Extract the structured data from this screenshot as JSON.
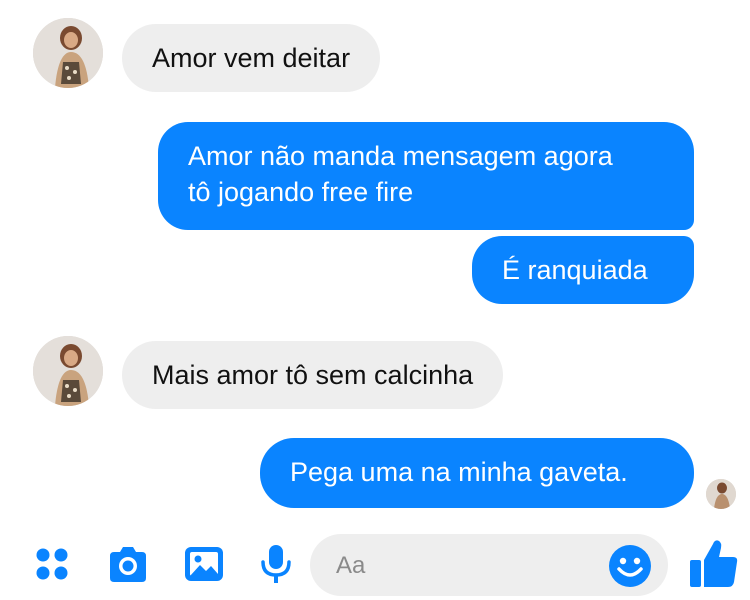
{
  "messages": [
    {
      "from": "contact",
      "text": "Amor vem deitar"
    },
    {
      "from": "me",
      "lines": [
        "Amor não manda mensagem agora",
        "tô jogando free fire"
      ]
    },
    {
      "from": "me",
      "lines": [
        "É ranquiada"
      ]
    },
    {
      "from": "contact",
      "text": "Mais amor tô sem calcinha"
    },
    {
      "from": "me",
      "lines": [
        "Pega uma na minha gaveta."
      ]
    }
  ],
  "composer": {
    "placeholder": "Aa",
    "icons": [
      "apps-icon",
      "camera-icon",
      "gallery-icon",
      "microphone-icon",
      "emoji-icon",
      "thumbs-up-icon"
    ]
  },
  "colors": {
    "outgoing_bubble": "#0a84ff",
    "incoming_bubble": "#eeeeee",
    "accent": "#0a84ff"
  }
}
